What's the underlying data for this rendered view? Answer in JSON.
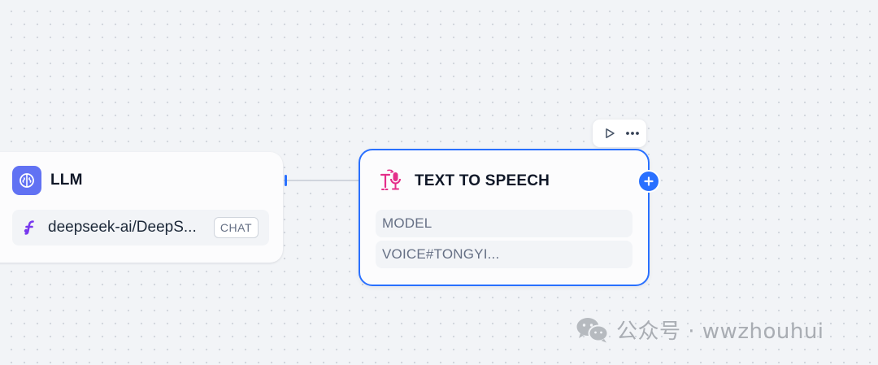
{
  "llm_node": {
    "title": "LLM",
    "icon": "brain-icon",
    "model_name": "deepseek-ai/DeepS...",
    "model_badge": "CHAT",
    "accent_color": "#6172f3"
  },
  "tts_node": {
    "title": "TEXT TO SPEECH",
    "icon": "text-to-speech-icon",
    "params": [
      "MODEL",
      "VOICE#TONGYI..."
    ],
    "accent_color": "#e42e8a",
    "selected_border_color": "#2970ff"
  },
  "toolbar": {
    "run_icon": "play-icon",
    "more_icon": "more-horizontal-icon"
  },
  "watermark": {
    "text": "公众号 · wwzhouhui",
    "icon": "wechat-icon"
  }
}
